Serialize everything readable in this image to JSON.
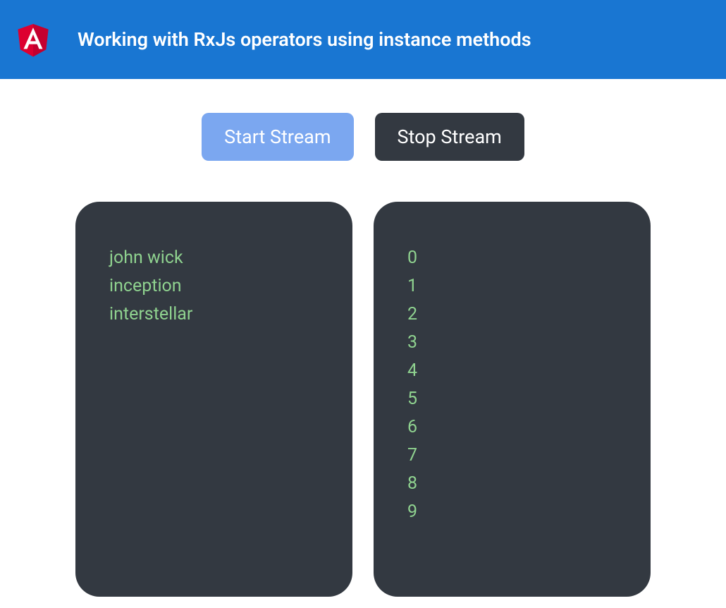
{
  "header": {
    "title": "Working with RxJs operators using instance methods"
  },
  "buttons": {
    "start_label": "Start Stream",
    "stop_label": "Stop Stream"
  },
  "panels": {
    "left": {
      "items": [
        "john wick",
        "inception",
        "interstellar"
      ]
    },
    "right": {
      "items": [
        "0",
        "1",
        "2",
        "3",
        "4",
        "5",
        "6",
        "7",
        "8",
        "9"
      ]
    }
  },
  "colors": {
    "header_bg": "#1976d2",
    "start_btn": "#7ba7f0",
    "stop_btn": "#333941",
    "panel_bg": "#333941",
    "item_text": "#8fd28f"
  }
}
